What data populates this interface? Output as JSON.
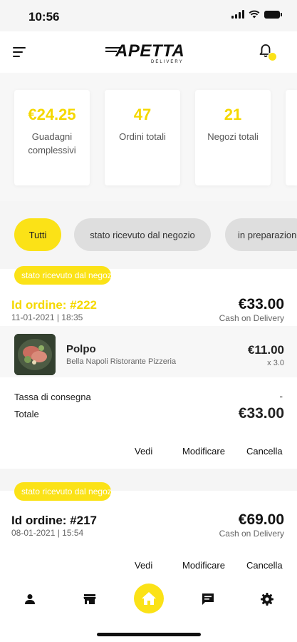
{
  "status_bar": {
    "time": "10:56"
  },
  "header": {
    "logo_text": "APETTA",
    "logo_sub": "DELIVERY"
  },
  "stats": [
    {
      "value": "€24.25",
      "label": "Guadagni complessivi"
    },
    {
      "value": "47",
      "label": "Ordini totali"
    },
    {
      "value": "21",
      "label": "Negozi totali"
    }
  ],
  "filters": {
    "all": "Tutti",
    "received": "stato ricevuto dal negozio",
    "preparing": "in preparazione"
  },
  "orders": [
    {
      "badge": "stato ricevuto dal negozio",
      "id": "Id ordine: #222",
      "date": "11-01-2021 | 18:35",
      "amount": "€33.00",
      "payment": "Cash on Delivery",
      "product_name": "Polpo",
      "product_store": "Bella Napoli Ristorante Pizzeria",
      "product_price": "€11.00",
      "product_qty": "x 3.0",
      "delivery_fee_label": "Tassa di consegna",
      "delivery_fee_value": "-",
      "total_label": "Totale",
      "total_value": "€33.00"
    },
    {
      "badge": "stato ricevuto dal negozio",
      "id": "Id ordine: #217",
      "date": "08-01-2021 | 15:54",
      "amount": "€69.00",
      "payment": "Cash on Delivery"
    }
  ],
  "actions": {
    "view": "Vedi",
    "edit": "Modificare",
    "cancel": "Cancella"
  },
  "colors": {
    "accent": "#fbe217",
    "pill_inactive": "#dedede"
  }
}
